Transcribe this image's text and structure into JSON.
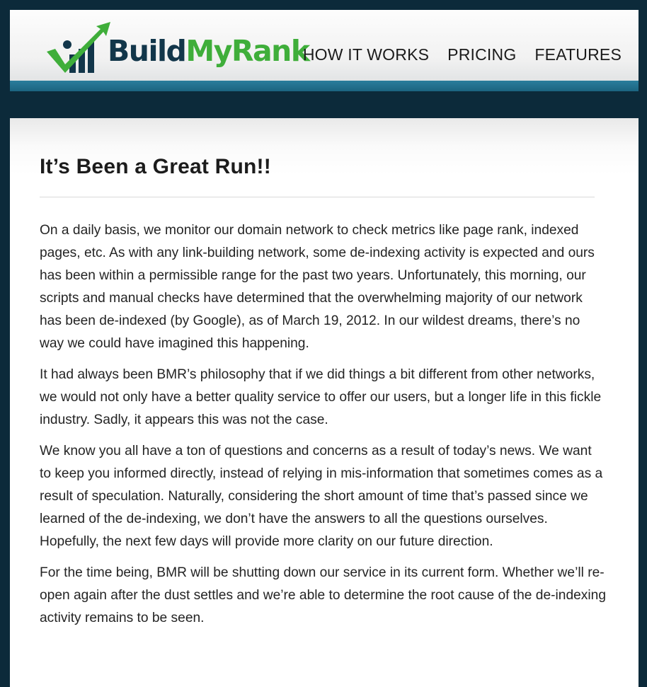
{
  "logo": {
    "build": "Build",
    "my": "My",
    "rank": "Rank",
    "colors": {
      "dark": "#12364a",
      "green": "#3fae3a"
    },
    "icon": "checkmark-bar-chart-arrow-icon"
  },
  "nav": {
    "items": [
      {
        "label": "HOW IT WORKS"
      },
      {
        "label": "PRICING"
      },
      {
        "label": "FEATURES"
      }
    ]
  },
  "colors": {
    "background": "#0c2a3a",
    "accent_strip": "#2a7d9c"
  },
  "article": {
    "title": "It’s Been a Great Run!!",
    "paragraphs": [
      "On a daily basis, we monitor our domain network to check metrics like page rank, indexed pages, etc. As with any link-building network, some de-indexing activity is expected and ours has been within a permissible range for the past two years. Unfortunately, this morning, our scripts and manual checks have determined that the overwhelming majority of our network has been de-indexed (by Google), as of March 19, 2012. In our wildest dreams, there’s no way we could have imagined this happening.",
      "It had always been BMR’s philosophy that if we did things a bit different from other networks, we would not only have a better quality service to offer our users, but a longer life in this fickle industry. Sadly, it appears this was not the case.",
      "We know you all have a ton of questions and concerns as a result of today’s news. We want to keep you informed directly, instead of relying in mis-information that sometimes comes as a result of speculation. Naturally, considering the short amount of time that’s passed since we learned of the de-indexing, we don’t have the answers to all the questions ourselves. Hopefully, the next few days will provide more clarity on our future direction.",
      "For the time being, BMR will be shutting down our service in its current form. Whether we’ll re-open again after the dust settles and we’re able to determine the root cause of the de-indexing activity remains to be seen."
    ]
  }
}
